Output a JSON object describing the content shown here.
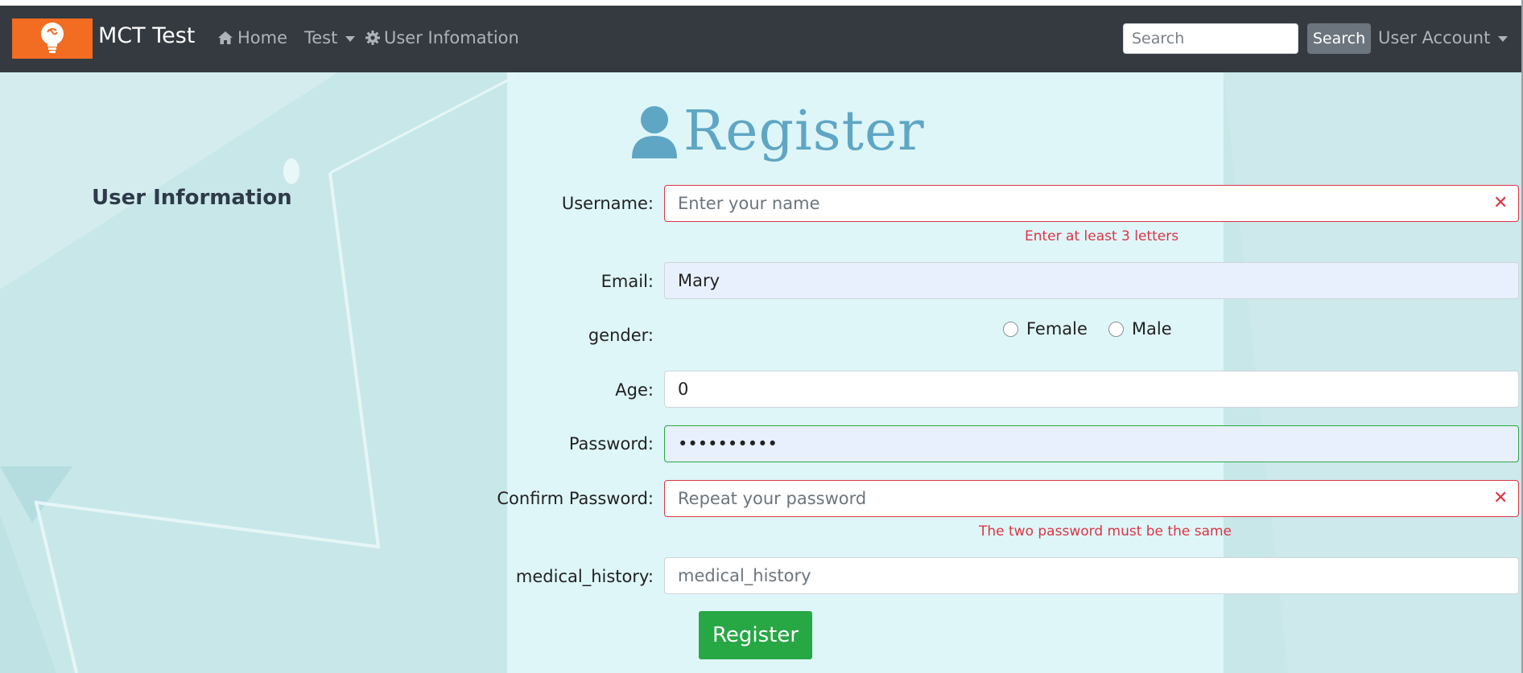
{
  "colors": {
    "navbar": "#343a40",
    "brand_accent": "#f26c22",
    "register_title": "#5fa6c4",
    "error": "#dc3545",
    "success": "#28a745",
    "page_bg": "#c9e8ea"
  },
  "navbar": {
    "brand": "MCT Test",
    "logo_icon": "lightbulb-icon",
    "items": [
      {
        "label": "Home",
        "icon": "home-icon"
      },
      {
        "label": "Test",
        "dropdown": true
      },
      {
        "label": "User Infomation",
        "icon": "gear-icon"
      }
    ],
    "search": {
      "placeholder": "Search",
      "button_label": "Search"
    },
    "account": {
      "label": "User Account",
      "dropdown": true
    }
  },
  "sidebar": {
    "title": "User Information"
  },
  "form": {
    "title": "Register",
    "title_icon": "user-icon",
    "fields": {
      "username": {
        "label": "Username:",
        "placeholder": "Enter your name",
        "value": "",
        "state": "invalid",
        "error": "Enter at least 3 letters"
      },
      "email": {
        "label": "Email:",
        "value": "Mary"
      },
      "gender": {
        "label": "gender:",
        "options": [
          "Female",
          "Male"
        ],
        "selected": null
      },
      "age": {
        "label": "Age:",
        "value": "0"
      },
      "password": {
        "label": "Password:",
        "value": "••••••••••",
        "state": "valid"
      },
      "confirm_password": {
        "label": "Confirm Password:",
        "placeholder": "Repeat your password",
        "value": "",
        "state": "invalid",
        "error": "The two password must be the same"
      },
      "medical_history": {
        "label": "medical_history:",
        "placeholder": "medical_history",
        "value": ""
      }
    },
    "submit_label": "Register"
  }
}
